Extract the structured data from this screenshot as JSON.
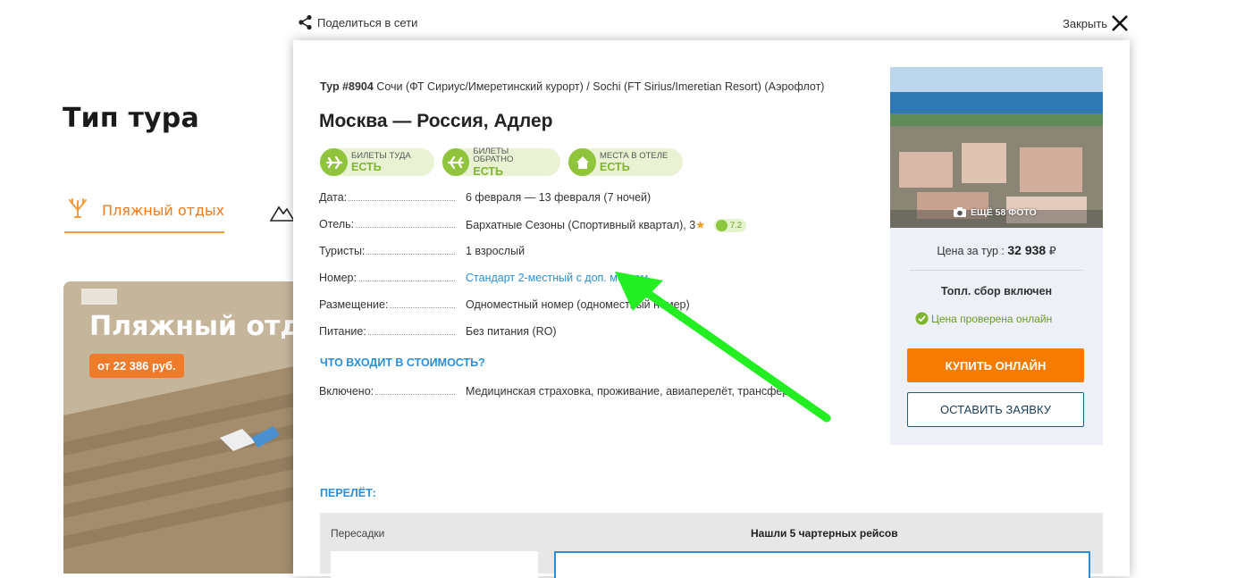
{
  "background": {
    "heading": "Тип тура",
    "tabs": [
      {
        "label": "Пляжный отдых",
        "icon": "coral-icon"
      },
      {
        "label": "",
        "icon": "mountains-icon"
      }
    ],
    "card": {
      "title": "Пляжный отдых",
      "price": "от 22 386 руб."
    }
  },
  "topbar": {
    "share_label": "Поделиться в сети",
    "close_label": "Закрыть"
  },
  "tour": {
    "number_label": "Тур #8904",
    "name": "Сочи (ФТ Сириус/Имеретинский курорт) / Sochi (FT Sirius/Imeretian Resort) (Аэрофлот)",
    "route": "Москва  —  Россия, Адлер"
  },
  "badges": [
    {
      "top": "БИЛЕТЫ ТУДА",
      "bottom": "ЕСТЬ",
      "icon": "plane-icon"
    },
    {
      "top": "БИЛЕТЫ ОБРАТНО",
      "bottom": "ЕСТЬ",
      "icon": "plane-return-icon"
    },
    {
      "top": "МЕСТА В ОТЕЛЕ",
      "bottom": "ЕСТЬ",
      "icon": "house-icon"
    }
  ],
  "details": {
    "date": {
      "label": "Дата:",
      "value": "6 февраля — 13 февраля (7 ночей)"
    },
    "hotel": {
      "label": "Отель:",
      "value": "Бархатные Сезоны (Спортивный квартал), 3",
      "star": "★",
      "rating": "7.2"
    },
    "tourists": {
      "label": "Туристы:",
      "value": "1 взрослый"
    },
    "room": {
      "label": "Номер:",
      "value": "Стандарт 2-местный с доп. местом"
    },
    "placement": {
      "label": "Размещение:",
      "value": "Одноместный номер (одноместный номер)"
    },
    "meals": {
      "label": "Питание:",
      "value": "Без питания (RO)"
    },
    "included": {
      "label": "Включено:",
      "value": "Медицинская страховка, проживание, авиаперелёт, трансфер"
    }
  },
  "whats_included_link": "ЧТО ВХОДИТ В СТОИМОСТЬ?",
  "flight": {
    "title": "ПЕРЕЛЁТ:",
    "transfers_label": "Пересадки",
    "found_label": "Нашли 5 чартерных рейсов"
  },
  "side": {
    "photo_label": "ЕЩЁ 58 ФОТО",
    "price_label": "Цена за тур :",
    "price_value": "32 938",
    "currency": "₽",
    "fuel_note": "Топл. сбор включен",
    "verified": "Цена проверена онлайн",
    "buy_button": "КУПИТЬ ОНЛАЙН",
    "request_button": "ОСТАВИТЬ ЗАЯВКУ"
  },
  "colors": {
    "accent_orange": "#f57c00",
    "link_blue": "#2c8fd6",
    "badge_green": "#8fc43c",
    "annotation_arrow": "#22ee22"
  }
}
